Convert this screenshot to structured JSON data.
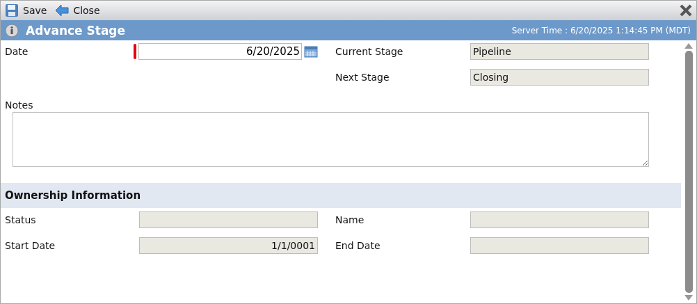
{
  "toolbar": {
    "buttons": [
      {
        "label": "Save",
        "kind": "save"
      },
      {
        "label": "Close",
        "kind": "back"
      }
    ]
  },
  "header": {
    "title": "Advance Stage",
    "server_time": "Server Time : 6/20/2025 1:14:45 PM (MDT)"
  },
  "stage_fields": {
    "date": {
      "label": "Date",
      "value": "6/20/2025",
      "required": true
    },
    "current_stage": {
      "label": "Current Stage",
      "value": "Pipeline"
    },
    "next_stage": {
      "label": "Next Stage",
      "value": "Closing"
    }
  },
  "notes": {
    "label": "Notes"
  },
  "ownership": {
    "title": "Ownership Information",
    "fields": [
      {
        "label": "Status"
      },
      {
        "label": "Name"
      },
      {
        "label": "Start Date",
        "value": "1/1/0001"
      },
      {
        "label": "End Date"
      }
    ]
  }
}
